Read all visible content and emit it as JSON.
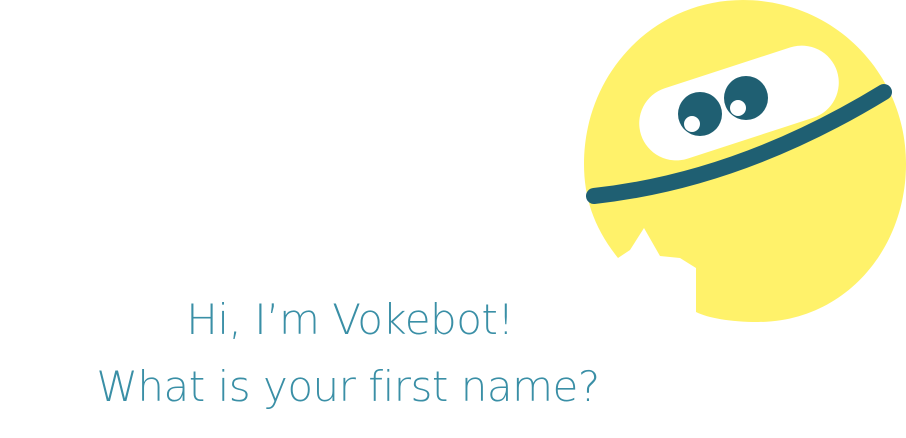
{
  "mascot": {
    "icon": "vokebot-mascot-icon",
    "body_color": "#fff26a",
    "band_color": "#1f5f72",
    "eye_color": "#1f5f72"
  },
  "greeting": {
    "line1": "Hi, I’m Vokebot!",
    "line2": "What is your first name?"
  },
  "colors": {
    "text": "#3a8fa6",
    "background": "#ffffff"
  }
}
